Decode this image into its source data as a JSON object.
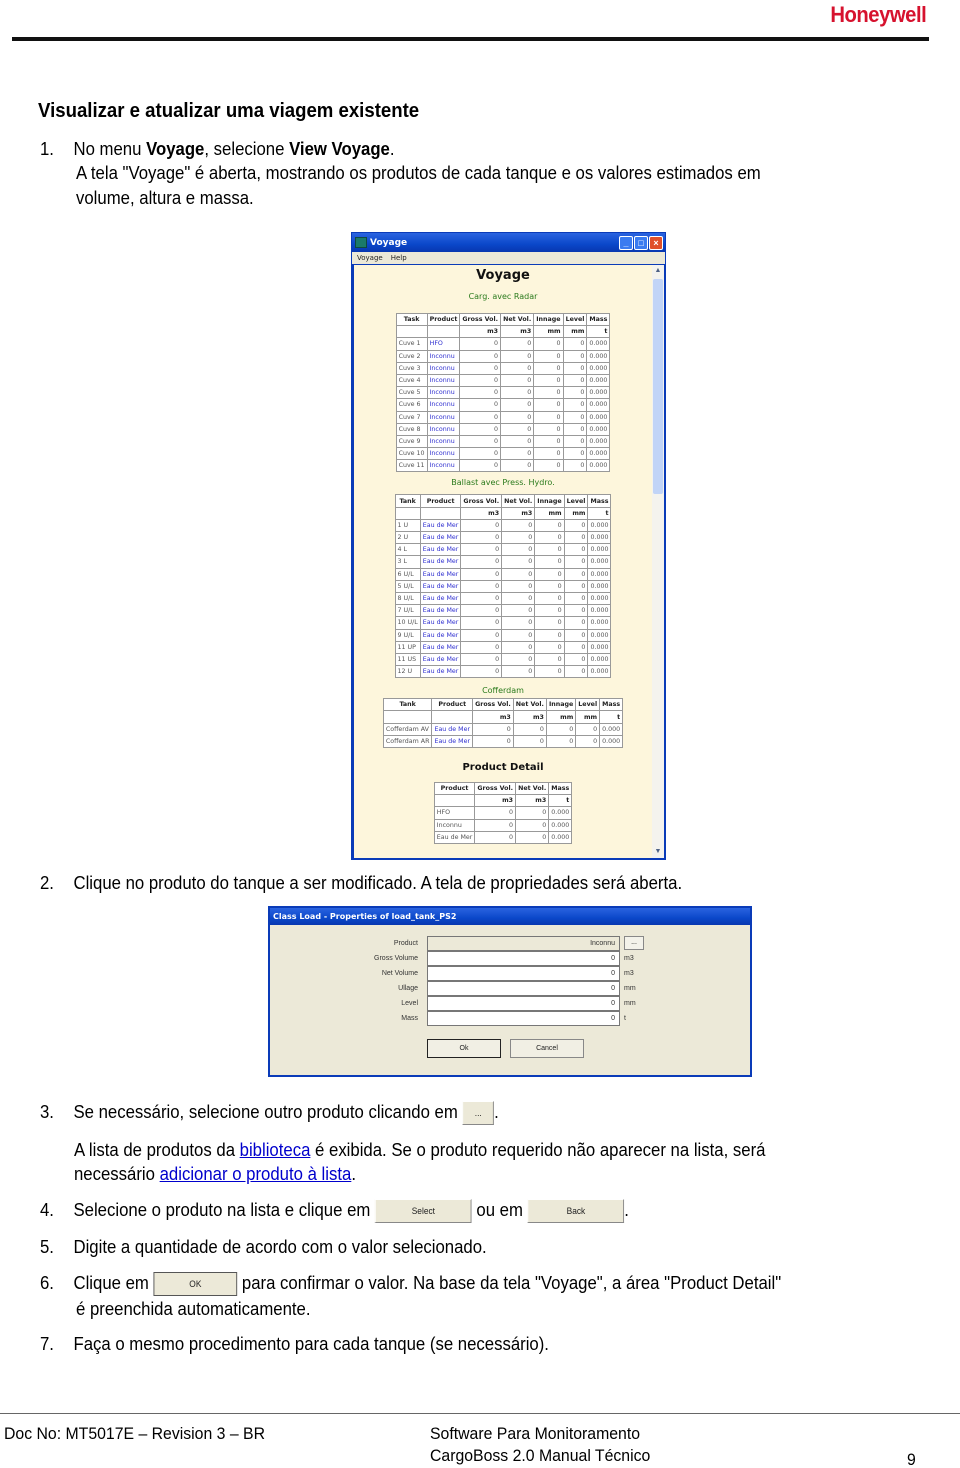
{
  "header": {
    "logo": "Honeywell"
  },
  "section_title": "Visualizar e atualizar uma viagem existente",
  "steps": {
    "s1": {
      "num": "1.",
      "pre": "No menu ",
      "b1": "Voyage",
      "mid": ", selecione ",
      "b2": "View Voyage",
      "post": ".",
      "line2": "A tela \"Voyage\" é aberta, mostrando os produtos de cada tanque e os valores estimados em",
      "line3": "volume, altura e massa."
    },
    "s2": {
      "num": "2.",
      "text": "Clique no produto do tanque a ser modificado. A tela de propriedades será aberta."
    },
    "s3": {
      "num": "3.",
      "text": "Se necessário, selecione outro produto clicando em",
      "button": "...",
      "after": ".",
      "line2_pre": "A lista de produtos da ",
      "line2_link": "biblioteca",
      "line2_post": " é exibida. Se o produto requerido não aparecer na lista, será",
      "line3_pre": "necessário ",
      "line3_link": "adicionar o produto à lista",
      "line3_post": "."
    },
    "s4": {
      "num": "4.",
      "text": "Selecione o produto na lista e clique em",
      "button1": "Select",
      "mid": "ou em",
      "button2": "Back",
      "after": "."
    },
    "s5": {
      "num": "5.",
      "text": "Digite a quantidade de acordo com o valor selecionado."
    },
    "s6": {
      "num": "6.",
      "pre": "Clique em",
      "button": "OK",
      "post": "para confirmar o valor. Na base da tela \"Voyage\", a área \"Product Detail\"",
      "line2": "é preenchida automaticamente."
    },
    "s7": {
      "num": "7.",
      "text": "Faça o mesmo procedimento para cada tanque (se necessário)."
    }
  },
  "voyage_window": {
    "title": "Voyage",
    "menu": [
      "Voyage",
      "Help"
    ],
    "heading": "Voyage",
    "cargo": {
      "title": "Carg. avec Radar",
      "headers": [
        "Task",
        "Product",
        "Gross Vol.",
        "Net Vol.",
        "Innage",
        "Level",
        "Mass"
      ],
      "units": [
        "",
        "",
        "m3",
        "m3",
        "mm",
        "mm",
        "t"
      ],
      "rows": [
        [
          "Cuve 1",
          "HFO",
          "0",
          "0",
          "0",
          "0",
          "0.000"
        ],
        [
          "Cuve 2",
          "Inconnu",
          "0",
          "0",
          "0",
          "0",
          "0.000"
        ],
        [
          "Cuve 3",
          "Inconnu",
          "0",
          "0",
          "0",
          "0",
          "0.000"
        ],
        [
          "Cuve 4",
          "Inconnu",
          "0",
          "0",
          "0",
          "0",
          "0.000"
        ],
        [
          "Cuve 5",
          "Inconnu",
          "0",
          "0",
          "0",
          "0",
          "0.000"
        ],
        [
          "Cuve 6",
          "Inconnu",
          "0",
          "0",
          "0",
          "0",
          "0.000"
        ],
        [
          "Cuve 7",
          "Inconnu",
          "0",
          "0",
          "0",
          "0",
          "0.000"
        ],
        [
          "Cuve 8",
          "Inconnu",
          "0",
          "0",
          "0",
          "0",
          "0.000"
        ],
        [
          "Cuve 9",
          "Inconnu",
          "0",
          "0",
          "0",
          "0",
          "0.000"
        ],
        [
          "Cuve 10",
          "Inconnu",
          "0",
          "0",
          "0",
          "0",
          "0.000"
        ],
        [
          "Cuve 11",
          "Inconnu",
          "0",
          "0",
          "0",
          "0",
          "0.000"
        ]
      ]
    },
    "ballast": {
      "title": "Ballast avec Press. Hydro.",
      "headers": [
        "Tank",
        "Product",
        "Gross Vol.",
        "Net Vol.",
        "Innage",
        "Level",
        "Mass"
      ],
      "units": [
        "",
        "",
        "m3",
        "m3",
        "mm",
        "mm",
        "t"
      ],
      "rows": [
        [
          "1 U",
          "Eau de Mer",
          "0",
          "0",
          "0",
          "0",
          "0.000"
        ],
        [
          "2 U",
          "Eau de Mer",
          "0",
          "0",
          "0",
          "0",
          "0.000"
        ],
        [
          "4 L",
          "Eau de Mer",
          "0",
          "0",
          "0",
          "0",
          "0.000"
        ],
        [
          "3 L",
          "Eau de Mer",
          "0",
          "0",
          "0",
          "0",
          "0.000"
        ],
        [
          "6 U/L",
          "Eau de Mer",
          "0",
          "0",
          "0",
          "0",
          "0.000"
        ],
        [
          "5 U/L",
          "Eau de Mer",
          "0",
          "0",
          "0",
          "0",
          "0.000"
        ],
        [
          "8 U/L",
          "Eau de Mer",
          "0",
          "0",
          "0",
          "0",
          "0.000"
        ],
        [
          "7 U/L",
          "Eau de Mer",
          "0",
          "0",
          "0",
          "0",
          "0.000"
        ],
        [
          "10 U/L",
          "Eau de Mer",
          "0",
          "0",
          "0",
          "0",
          "0.000"
        ],
        [
          "9 U/L",
          "Eau de Mer",
          "0",
          "0",
          "0",
          "0",
          "0.000"
        ],
        [
          "11 UP",
          "Eau de Mer",
          "0",
          "0",
          "0",
          "0",
          "0.000"
        ],
        [
          "11 US",
          "Eau de Mer",
          "0",
          "0",
          "0",
          "0",
          "0.000"
        ],
        [
          "12 U",
          "Eau de Mer",
          "0",
          "0",
          "0",
          "0",
          "0.000"
        ]
      ]
    },
    "cofferdam": {
      "title": "Cofferdam",
      "headers": [
        "Tank",
        "Product",
        "Gross Vol.",
        "Net Vol.",
        "Innage",
        "Level",
        "Mass"
      ],
      "units": [
        "",
        "",
        "m3",
        "m3",
        "mm",
        "mm",
        "t"
      ],
      "rows": [
        [
          "Cofferdam AV",
          "Eau de Mer",
          "0",
          "0",
          "0",
          "0",
          "0.000"
        ],
        [
          "Cofferdam AR",
          "Eau de Mer",
          "0",
          "0",
          "0",
          "0",
          "0.000"
        ]
      ]
    },
    "product_detail": {
      "title": "Product Detail",
      "headers": [
        "Product",
        "Gross Vol.",
        "Net Vol.",
        "Mass"
      ],
      "units": [
        "",
        "m3",
        "m3",
        "t"
      ],
      "rows": [
        [
          "HFO",
          "0",
          "0",
          "0.000"
        ],
        [
          "Inconnu",
          "0",
          "0",
          "0.000"
        ],
        [
          "Eau de Mer",
          "0",
          "0",
          "0.000"
        ]
      ]
    }
  },
  "dialog": {
    "title": "Class Load - Properties of load_tank_PS2",
    "fields": [
      {
        "label": "Product",
        "value": "Inconnu",
        "unit": ""
      },
      {
        "label": "Gross Volume",
        "value": "0",
        "unit": "m3"
      },
      {
        "label": "Net Volume",
        "value": "0",
        "unit": "m3"
      },
      {
        "label": "Ullage",
        "value": "0",
        "unit": "mm"
      },
      {
        "label": "Level",
        "value": "0",
        "unit": "mm"
      },
      {
        "label": "Mass",
        "value": "0",
        "unit": "t"
      }
    ],
    "browse_label": "...",
    "ok_label": "Ok",
    "cancel_label": "Cancel"
  },
  "footer": {
    "doc_no": "Doc No: MT5017E – Revision 3 – BR",
    "title_line1": "Software Para Monitoramento",
    "title_line2": "CargoBoss 2.0 Manual Técnico",
    "page": "9"
  },
  "colors": {
    "brand": "#d6122e",
    "link": "#0000cc",
    "section_green": "#2a7a1c",
    "xp_blue": "#0a47c9",
    "window_bg": "#fdf6dc"
  }
}
